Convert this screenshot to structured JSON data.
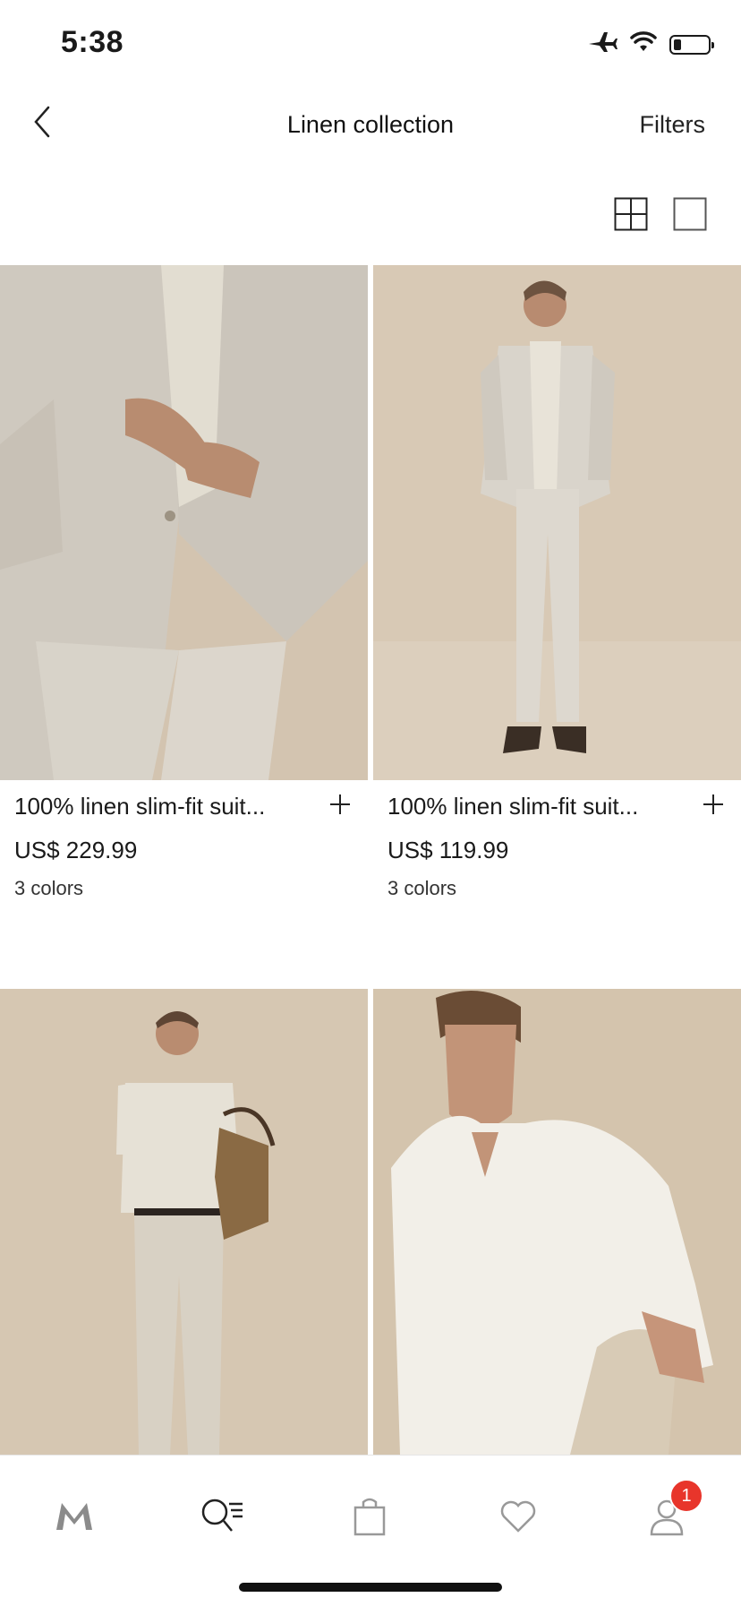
{
  "status_bar": {
    "time": "5:38",
    "battery_level": 0.2
  },
  "header": {
    "title": "Linen collection",
    "filters_label": "Filters"
  },
  "products": [
    {
      "name": "100% linen slim-fit suit...",
      "price": "US$ 229.99",
      "colors": "3 colors"
    },
    {
      "name": "100% linen slim-fit suit...",
      "price": "US$ 119.99",
      "colors": "3 colors"
    },
    {
      "name": "",
      "price": "",
      "colors": ""
    },
    {
      "name": "",
      "price": "",
      "colors": ""
    }
  ],
  "tab_bar": {
    "profile_badge": "1"
  },
  "colors": {
    "accent": "#e8352b",
    "image_background": "#d9cbb9"
  },
  "icons": [
    "back-chevron-icon",
    "grid-view-icon",
    "single-view-icon",
    "plus-icon",
    "brand-logo-icon",
    "search-menu-icon",
    "shopping-bag-icon",
    "heart-icon",
    "user-icon"
  ]
}
